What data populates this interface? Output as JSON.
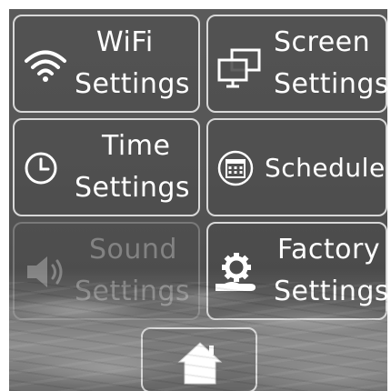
{
  "tiles": {
    "wifi": {
      "line1": "WiFi",
      "line2": "Settings",
      "icon": "wifi-icon"
    },
    "screen": {
      "line1": "Screen",
      "line2": "Settings",
      "icon": "monitors-icon"
    },
    "time": {
      "line1": "Time",
      "line2": "Settings",
      "icon": "clock-icon"
    },
    "schedule": {
      "line1": "Schedule",
      "icon": "calendar-icon"
    },
    "sound": {
      "line1": "Sound",
      "line2": "Settings",
      "icon": "speaker-icon",
      "state": "disabled"
    },
    "factory": {
      "line1": "Factory",
      "line2": "Settings",
      "icon": "gear-hand-icon"
    }
  },
  "home": {
    "icon": "home-icon"
  },
  "colors": {
    "text": "#ffffff",
    "border": "#d8d8d8",
    "background": "#555555"
  }
}
